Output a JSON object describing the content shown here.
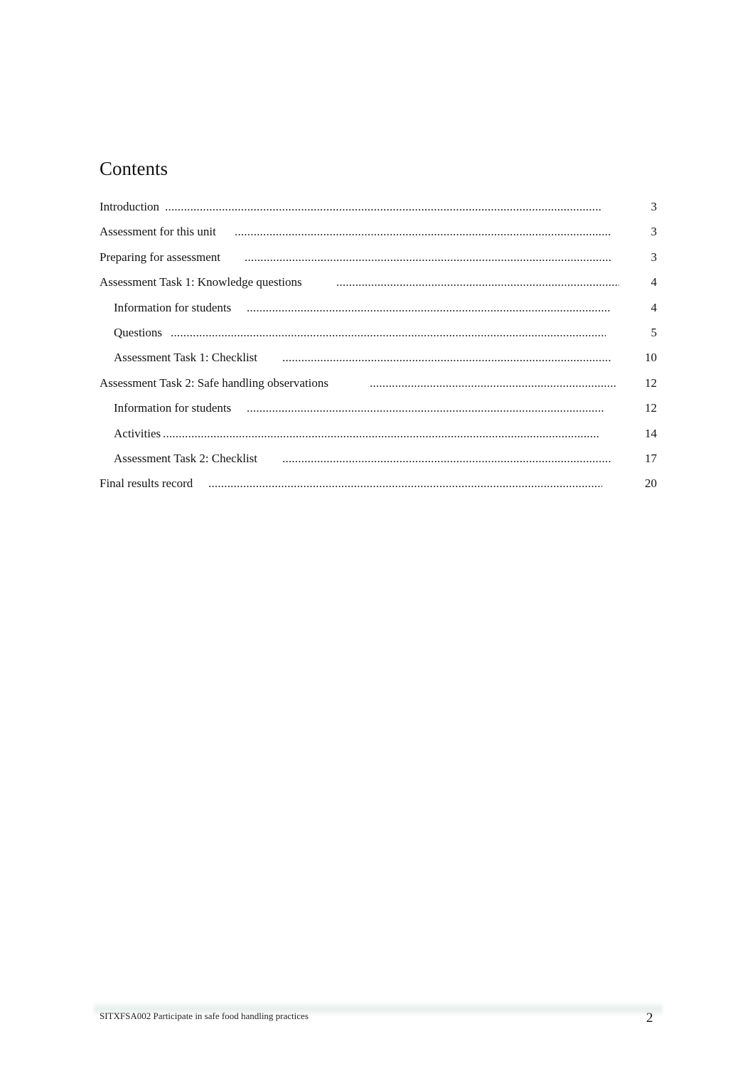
{
  "document": {
    "title": "Contents",
    "toc": [
      {
        "label": "Introduction",
        "page": "3",
        "level": 1
      },
      {
        "label": "Assessment for this unit",
        "page": "3",
        "level": 1
      },
      {
        "label": "Preparing for assessment",
        "page": "3",
        "level": 1
      },
      {
        "label": "Assessment Task 1: Knowledge questions",
        "page": "4",
        "level": 1
      },
      {
        "label": "Information for students",
        "page": "4",
        "level": 2
      },
      {
        "label": "Questions",
        "page": "5",
        "level": 2
      },
      {
        "label": "Assessment Task 1: Checklist",
        "page": "10",
        "level": 2
      },
      {
        "label": "Assessment Task 2: Safe handling observations",
        "page": "12",
        "level": 1
      },
      {
        "label": "Information for students",
        "page": "12",
        "level": 2
      },
      {
        "label": "Activities",
        "page": "14",
        "level": 2
      },
      {
        "label": "Assessment Task 2: Checklist",
        "page": "17",
        "level": 2
      },
      {
        "label": "Final results record",
        "page": "20",
        "level": 1
      }
    ],
    "footer": {
      "text": "SITXFSA002 Participate in safe food handling practices",
      "page_number": "2"
    }
  }
}
